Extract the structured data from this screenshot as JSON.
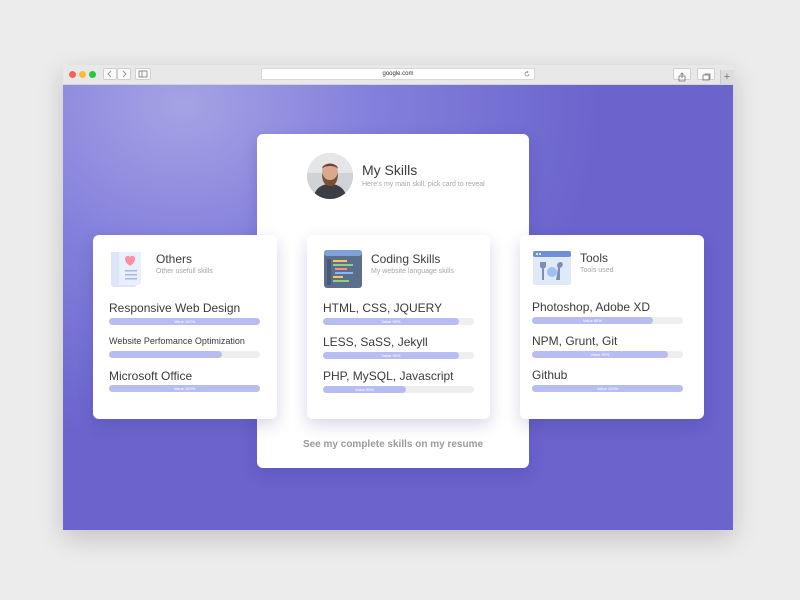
{
  "browser": {
    "url": "google.com",
    "new_tab_label": "+"
  },
  "profile": {
    "title": "My Skills",
    "subtitle": "Here's my main skill, pick card to reveal",
    "resume_link": "See my complete skills on my resume"
  },
  "cards": {
    "others": {
      "title": "Others",
      "subtitle": "Other usefull skills",
      "icon": "document-heart-icon",
      "skills": [
        {
          "name": "Responsive Web Design",
          "level": 1.0,
          "label": "Value 100%"
        },
        {
          "name": "Website Perfomance Optimization",
          "level": 0.75,
          "label": ""
        },
        {
          "name": "Microsoft Office",
          "level": 1.0,
          "label": "Value 100%"
        }
      ]
    },
    "coding": {
      "title": "Coding Skills",
      "subtitle": "My website language skills",
      "icon": "code-editor-icon",
      "skills": [
        {
          "name": "HTML, CSS, JQUERY",
          "level": 0.9,
          "label": "Value 90%"
        },
        {
          "name": "LESS, SaSS, Jekyll",
          "level": 0.9,
          "label": "Value 90%"
        },
        {
          "name": "PHP, MySQL, Javascript",
          "level": 0.55,
          "label": "Value 55%"
        }
      ]
    },
    "tools": {
      "title": "Tools",
      "subtitle": "Tools used",
      "icon": "tools-browser-icon",
      "skills": [
        {
          "name": "Photoshop, Adobe XD",
          "level": 0.8,
          "label": "Value 80%"
        },
        {
          "name": "NPM, Grunt, Git",
          "level": 0.9,
          "label": "Value 90%"
        },
        {
          "name": "Github",
          "level": 1.0,
          "label": "Value 100%"
        }
      ]
    }
  },
  "colors": {
    "background_start": "#a5a3e4",
    "background_end": "#6a64cc",
    "bar_fill": "#b7bdf1",
    "bar_track": "#eeeeee"
  }
}
